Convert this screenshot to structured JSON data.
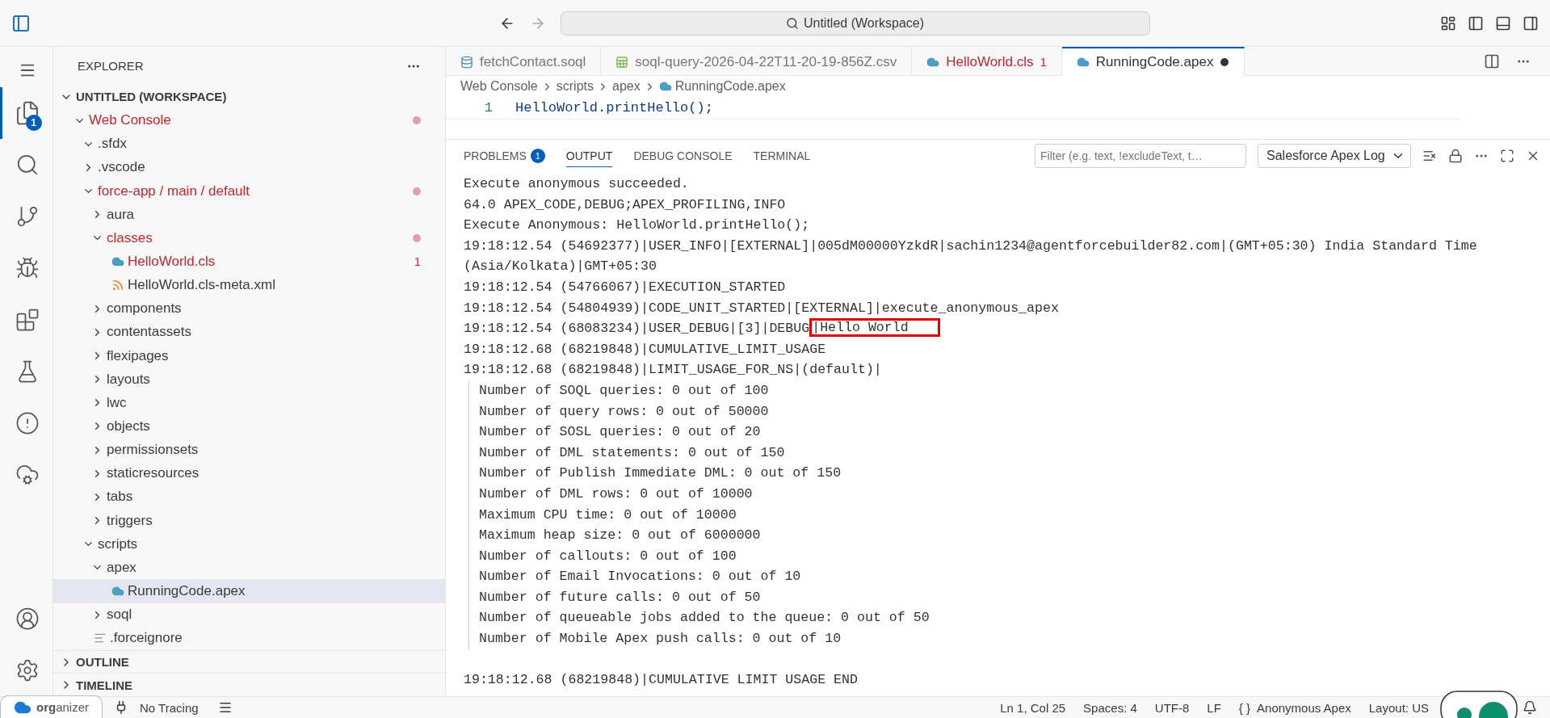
{
  "title_bar": {
    "search": "Untitled (Workspace)"
  },
  "activity_bar": {
    "badge": "1"
  },
  "sidebar": {
    "title": "EXPLORER",
    "workspace": {
      "label": "UNTITLED (WORKSPACE)",
      "expanded": true
    },
    "tree": [
      {
        "label": "Web Console",
        "kind": "folder",
        "expanded": true,
        "problems": true,
        "selected": false,
        "children": [
          {
            "label": ".sfdx",
            "kind": "folder",
            "expanded": true,
            "problems": false,
            "selected": false
          },
          {
            "label": ".vscode",
            "kind": "folder",
            "expanded": false,
            "problems": false,
            "selected": false
          },
          {
            "label": "force-app / main / default",
            "kind": "folder",
            "expanded": true,
            "problems": true,
            "selected": false,
            "children": [
              {
                "label": "aura",
                "kind": "folder",
                "expanded": false,
                "problems": false,
                "selected": false
              },
              {
                "label": "classes",
                "kind": "folder",
                "expanded": true,
                "problems": true,
                "selected": false,
                "children": [
                  {
                    "label": "HelloWorld.cls",
                    "kind": "apex",
                    "problems": true,
                    "badge": "1",
                    "selected": false
                  },
                  {
                    "label": "HelloWorld.cls-meta.xml",
                    "kind": "xml",
                    "problems": false,
                    "selected": false
                  }
                ]
              },
              {
                "label": "components",
                "kind": "folder",
                "expanded": false,
                "problems": false,
                "selected": false
              },
              {
                "label": "contentassets",
                "kind": "folder",
                "expanded": false,
                "problems": false,
                "selected": false
              },
              {
                "label": "flexipages",
                "kind": "folder",
                "expanded": false,
                "problems": false,
                "selected": false
              },
              {
                "label": "layouts",
                "kind": "folder",
                "expanded": false,
                "problems": false,
                "selected": false
              },
              {
                "label": "lwc",
                "kind": "folder",
                "expanded": false,
                "problems": false,
                "selected": false
              },
              {
                "label": "objects",
                "kind": "folder",
                "expanded": false,
                "problems": false,
                "selected": false
              },
              {
                "label": "permissionsets",
                "kind": "folder",
                "expanded": false,
                "problems": false,
                "selected": false
              },
              {
                "label": "staticresources",
                "kind": "folder",
                "expanded": false,
                "problems": false,
                "selected": false
              },
              {
                "label": "tabs",
                "kind": "folder",
                "expanded": false,
                "problems": false,
                "selected": false
              },
              {
                "label": "triggers",
                "kind": "folder",
                "expanded": false,
                "problems": false,
                "selected": false
              }
            ]
          },
          {
            "label": "scripts",
            "kind": "folder",
            "expanded": true,
            "problems": false,
            "selected": false,
            "children": [
              {
                "label": "apex",
                "kind": "folder",
                "expanded": true,
                "problems": false,
                "selected": false,
                "children": [
                  {
                    "label": "RunningCode.apex",
                    "kind": "apex",
                    "problems": false,
                    "selected": true
                  }
                ]
              },
              {
                "label": "soql",
                "kind": "folder",
                "expanded": false,
                "problems": false,
                "selected": false
              }
            ]
          },
          {
            "label": ".forceignore",
            "kind": "text",
            "problems": false,
            "selected": false
          }
        ]
      }
    ],
    "sections": [
      {
        "label": "OUTLINE",
        "expanded": false
      },
      {
        "label": "TIMELINE",
        "expanded": false
      }
    ]
  },
  "editor_tabs": [
    {
      "label": "fetchContact.soql",
      "kind": "soql",
      "selected": false,
      "problems": false
    },
    {
      "label": "soql-query-2026-04-22T11-20-19-856Z.csv",
      "kind": "csv",
      "selected": false,
      "problems": false
    },
    {
      "label": "HelloWorld.cls",
      "kind": "apex",
      "selected": false,
      "problems": true,
      "badge": "1"
    },
    {
      "label": "RunningCode.apex",
      "kind": "apex",
      "selected": true,
      "problems": false,
      "dirty": true
    }
  ],
  "breadcrumb": [
    "Web Console",
    "scripts",
    "apex",
    "RunningCode.apex"
  ],
  "code": [
    {
      "number": "1",
      "text": "HelloWorld.printHello();"
    }
  ],
  "panel": {
    "tabs": [
      {
        "label": "PROBLEMS",
        "badge": "1",
        "selected": false
      },
      {
        "label": "OUTPUT",
        "selected": true
      },
      {
        "label": "DEBUG CONSOLE",
        "selected": false
      },
      {
        "label": "TERMINAL",
        "selected": false
      }
    ],
    "filter": {
      "placeholder": "Filter (e.g. text, !excludeText, t…"
    },
    "channel": "Salesforce Apex Log",
    "output": [
      {
        "kind": "plain",
        "text": "Execute anonymous succeeded."
      },
      {
        "kind": "plain",
        "text": "64.0 APEX_CODE,DEBUG;APEX_PROFILING,INFO"
      },
      {
        "kind": "plain",
        "text": "Execute Anonymous: HelloWorld.printHello();"
      },
      {
        "kind": "plain",
        "text": "19:18:12.54 (54692377)|USER_INFO|[EXTERNAL]|005dM00000YzkdR|sachin1234@agentforcebuilder82.com|(GMT+05:30) India Standard Time"
      },
      {
        "kind": "plain",
        "text": "(Asia/Kolkata)|GMT+05:30"
      },
      {
        "kind": "plain",
        "text": "19:18:12.54 (54766067)|EXECUTION_STARTED"
      },
      {
        "kind": "plain",
        "text": "19:18:12.54 (54804939)|CODE_UNIT_STARTED|[EXTERNAL]|execute_anonymous_apex"
      },
      {
        "kind": "plain",
        "text": "19:18:12.54 (68083234)|USER_DEBUG|[3]|DEBUG",
        "highlighted": "|Hello World"
      },
      {
        "kind": "plain",
        "text": "19:18:12.68 (68219848)|CUMULATIVE_LIMIT_USAGE"
      },
      {
        "kind": "plain",
        "text": "19:18:12.68 (68219848)|LIMIT_USAGE_FOR_NS|(default)|"
      },
      {
        "kind": "indented",
        "text": "Number of SOQL queries: 0 out of 100"
      },
      {
        "kind": "indented",
        "text": "Number of query rows: 0 out of 50000"
      },
      {
        "kind": "indented",
        "text": "Number of SOSL queries: 0 out of 20"
      },
      {
        "kind": "indented",
        "text": "Number of DML statements: 0 out of 150"
      },
      {
        "kind": "indented",
        "text": "Number of Publish Immediate DML: 0 out of 150"
      },
      {
        "kind": "indented",
        "text": "Number of DML rows: 0 out of 10000"
      },
      {
        "kind": "indented",
        "text": "Maximum CPU time: 0 out of 10000"
      },
      {
        "kind": "indented",
        "text": "Maximum heap size: 0 out of 6000000"
      },
      {
        "kind": "indented",
        "text": "Number of callouts: 0 out of 100"
      },
      {
        "kind": "indented",
        "text": "Number of Email Invocations: 0 out of 10"
      },
      {
        "kind": "indented",
        "text": "Number of future calls: 0 out of 50"
      },
      {
        "kind": "indented",
        "text": "Number of queueable jobs added to the queue: 0 out of 50"
      },
      {
        "kind": "indented",
        "text": "Number of Mobile Apex push calls: 0 out of 10"
      },
      {
        "kind": "spaced",
        "text": "19:18:12.68 (68219848)|CUMULATIVE LIMIT USAGE END"
      }
    ]
  },
  "status_bar": {
    "org": "**org**anizer",
    "tracing": "No Tracing",
    "items": [
      "Ln 1, Col 25",
      "Spaces: 4",
      "UTF-8",
      "LF"
    ],
    "braces": "{ }",
    "language": "Anonymous Apex",
    "layout": "Layout: US"
  }
}
